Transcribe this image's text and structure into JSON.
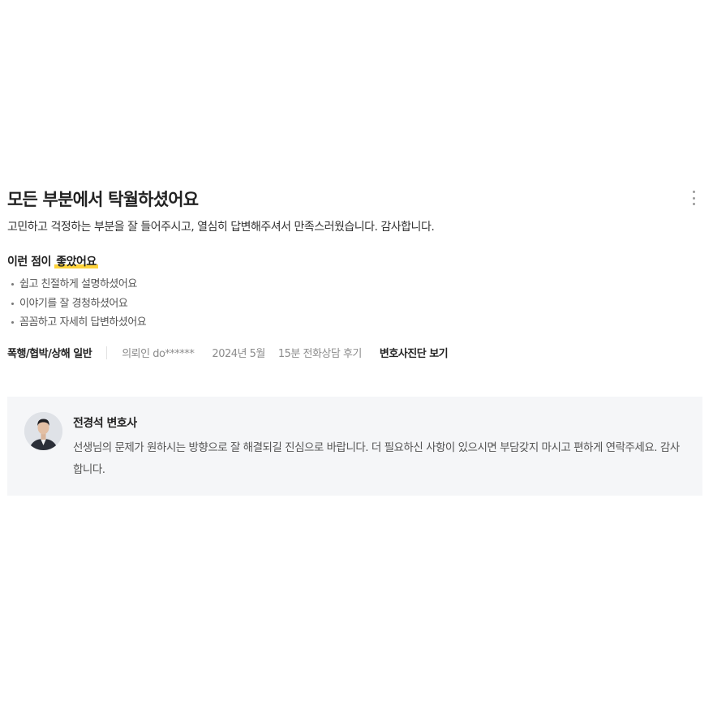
{
  "review": {
    "title": "모든 부분에서 탁월하셨어요",
    "body": "고민하고 걱정하는 부분을 잘 들어주시고, 열심히 답변해주셔서 만족스러웠습니다. 감사합니다.",
    "good_points": {
      "heading_prefix": "이런 점이",
      "heading_highlight": "좋았어요",
      "items": [
        "쉽고 친절하게 설명하셨어요",
        "이야기를 잘 경청하셨어요",
        "꼼꼼하고 자세히 답변하셨어요"
      ]
    },
    "meta": {
      "category": "폭행/협박/상해 일반",
      "client": "의뢰인 do******",
      "date": "2024년 5월",
      "consult_type": "15분 전화상담 후기",
      "diagnosis_link": "변호사진단 보기"
    }
  },
  "reply": {
    "lawyer_name": "전경석 변호사",
    "text": "선생님의 문제가 원하시는 방향으로 잘 해결되길 진심으로 바랍니다. 더 필요하신 사항이 있으시면 부담갖지 마시고 편하게 연락주세요. 감사합니다."
  },
  "colors": {
    "highlight": "#ffd43b",
    "reply_background": "#f5f6f8"
  }
}
